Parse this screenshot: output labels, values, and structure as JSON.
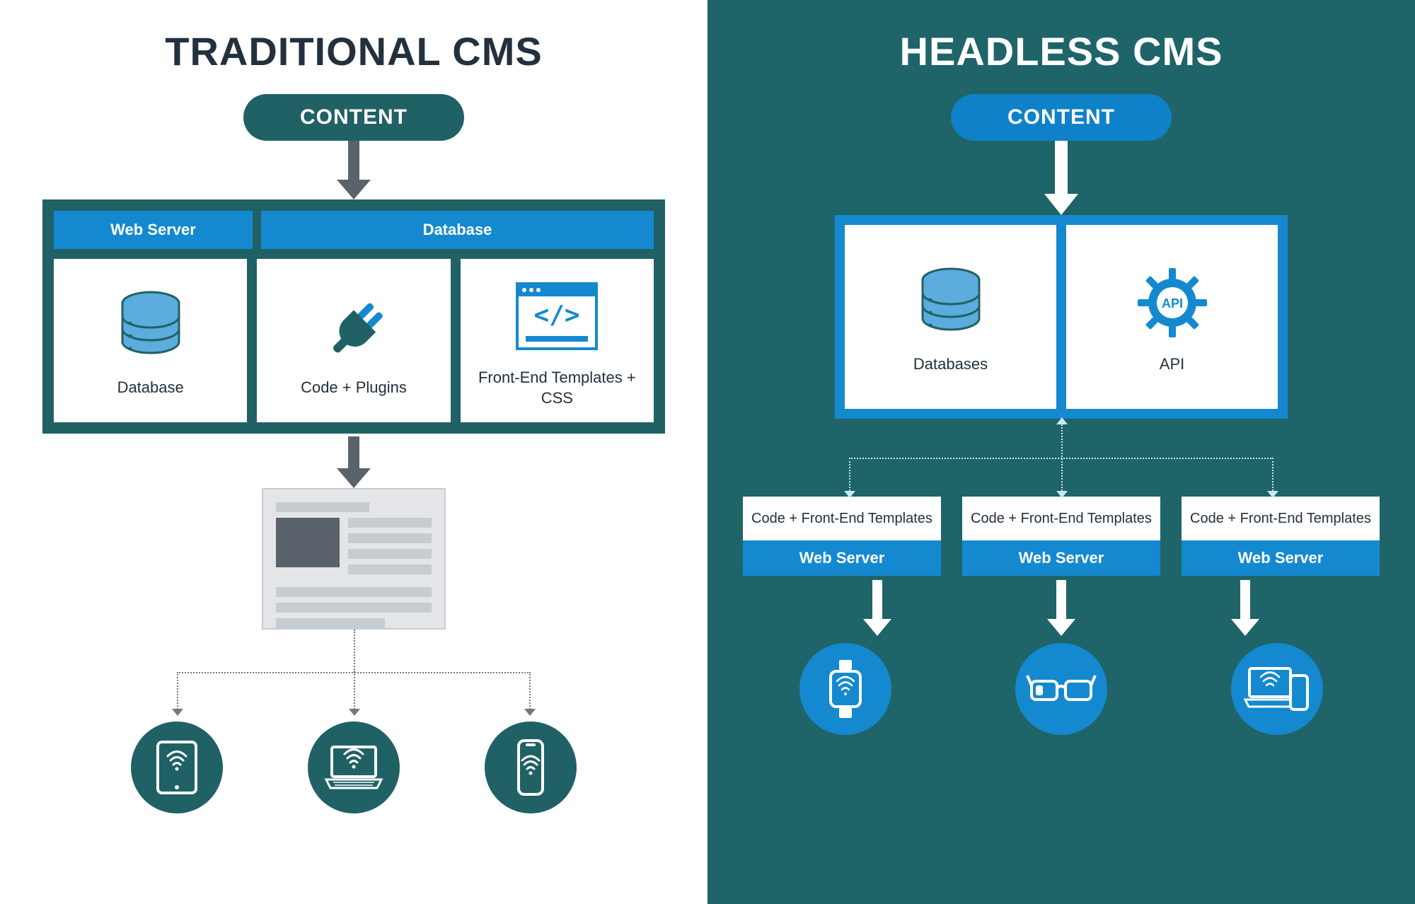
{
  "left": {
    "title": "TRADITIONAL CMS",
    "content_label": "CONTENT",
    "stack_headers": [
      "Web Server",
      "Database"
    ],
    "cards": [
      {
        "label": "Database",
        "icon": "database-icon"
      },
      {
        "label": "Code + Plugins",
        "icon": "plug-icon"
      },
      {
        "label": "Front-End Templates + CSS",
        "icon": "code-template-icon"
      }
    ],
    "devices": [
      "tablet-icon",
      "laptop-icon",
      "phone-icon"
    ]
  },
  "right": {
    "title": "HEADLESS CMS",
    "content_label": "CONTENT",
    "backend_cards": [
      {
        "label": "Databases",
        "icon": "database-icon"
      },
      {
        "label": "API",
        "icon": "api-gear-icon"
      }
    ],
    "frontends": [
      {
        "top": "Code + Front-End Templates",
        "bottom": "Web Server"
      },
      {
        "top": "Code + Front-End Templates",
        "bottom": "Web Server"
      },
      {
        "top": "Code + Front-End Templates",
        "bottom": "Web Server"
      }
    ],
    "devices": [
      "smartwatch-icon",
      "smart-glasses-icon",
      "laptop-phone-icon"
    ]
  },
  "colors": {
    "teal": "#206165",
    "teal_bg": "#1e6468",
    "blue": "#1589cf",
    "blue_light": "#5cacdd",
    "gray": "#5a626b",
    "light_gray": "#c7ccd1"
  }
}
